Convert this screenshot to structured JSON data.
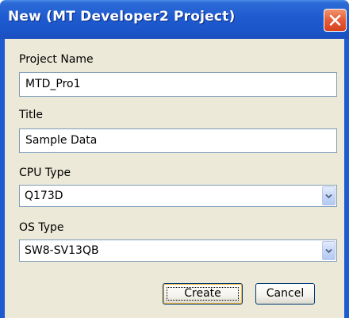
{
  "window": {
    "title": "New (MT Developer2 Project)",
    "close_icon": "close-x-icon"
  },
  "form": {
    "project_name": {
      "label": "Project Name",
      "value": "MTD_Pro1"
    },
    "title": {
      "label": "Title",
      "value": "Sample Data"
    },
    "cpu_type": {
      "label": "CPU Type",
      "value": "Q173D",
      "arrow_icon": "chevron-down-icon"
    },
    "os_type": {
      "label": "OS Type",
      "value": "SW8-SV13QB",
      "arrow_icon": "chevron-down-icon"
    }
  },
  "buttons": {
    "create_label": "Create",
    "cancel_label": "Cancel"
  },
  "colors": {
    "titlebar": "#1f5bd0",
    "dialog_background": "#ece9d8",
    "close_button": "#e5603a",
    "field_border": "#7f9db9"
  }
}
